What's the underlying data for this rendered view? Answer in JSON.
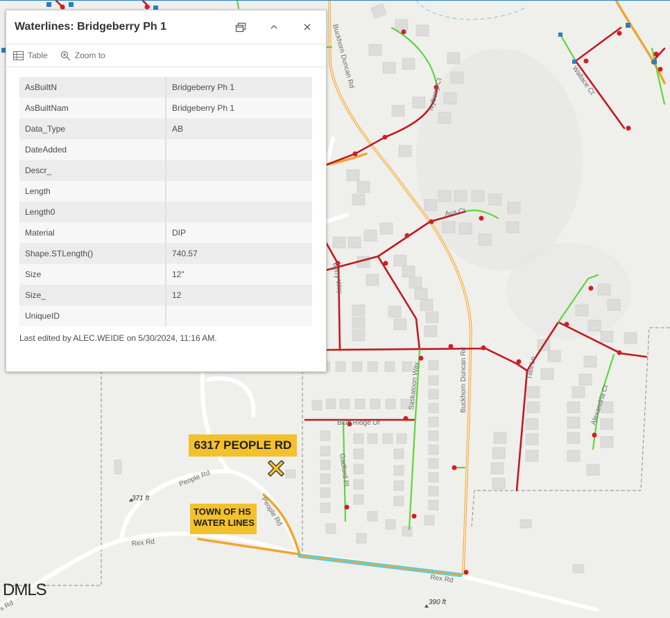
{
  "popup": {
    "title": "Waterlines: Bridgeberry Ph 1",
    "actions": {
      "table": "Table",
      "zoom": "Zoom to"
    },
    "attributes": [
      {
        "key": "AsBuiltN",
        "value": "Bridgeberry Ph 1"
      },
      {
        "key": "AsBuiltNam",
        "value": "Bridgeberry Ph 1"
      },
      {
        "key": "Data_Type",
        "value": "AB"
      },
      {
        "key": "DateAdded",
        "value": ""
      },
      {
        "key": "Descr_",
        "value": ""
      },
      {
        "key": "Length",
        "value": ""
      },
      {
        "key": "Length0",
        "value": ""
      },
      {
        "key": "Material",
        "value": "DIP"
      },
      {
        "key": "Shape.STLength()",
        "value": "740.57"
      },
      {
        "key": "Size",
        "value": "12\""
      },
      {
        "key": "Size_",
        "value": "12"
      },
      {
        "key": "UniqueID",
        "value": ""
      }
    ],
    "last_edited": "Last edited by ALEC.WEIDE on 5/30/2024, 11:16 AM."
  },
  "callouts": {
    "address": "6317 PEOPLE RD",
    "town_line1": "TOWN OF HS",
    "town_line2": "WATER LINES"
  },
  "map_labels": {
    "buckhorn_duncan_rd": "Buckhorn Duncan Rd",
    "buckhorn_duncan_rd_top": "Buckhorn Duncan Rd",
    "ivyberry_ct": "Ivyberry Ct",
    "ava_ct": "Ava Ct",
    "saskatoon_way": "Saskatoon Way",
    "bluff_ridge_dr": "Bluff Ridge Dr",
    "gadford_pl": "Gadford Pl",
    "tillis_ln": "Tillis Ln",
    "alexandria_ct": "Alexandria Ct",
    "people_rd": "People Rd",
    "people_rd_2": "People Rd",
    "rex_rd_left": "Rex Rd",
    "rex_rd_right": "Rex Rd",
    "rex_rd_corner": "x Rd",
    "elev_371": "371 ft",
    "elev_390": "390 ft",
    "berry_way": "berry Way",
    "wallace_ct": "Wallace Ct"
  },
  "watermark": "DMLS",
  "colors": {
    "map_background": "#efefec",
    "highway": "#f0a630",
    "water_main": "#c0191f",
    "water_service": "#5fd43a",
    "selected_line": "#3cc6d8",
    "callout": "#f3c12c",
    "building": "#dcdcda"
  }
}
